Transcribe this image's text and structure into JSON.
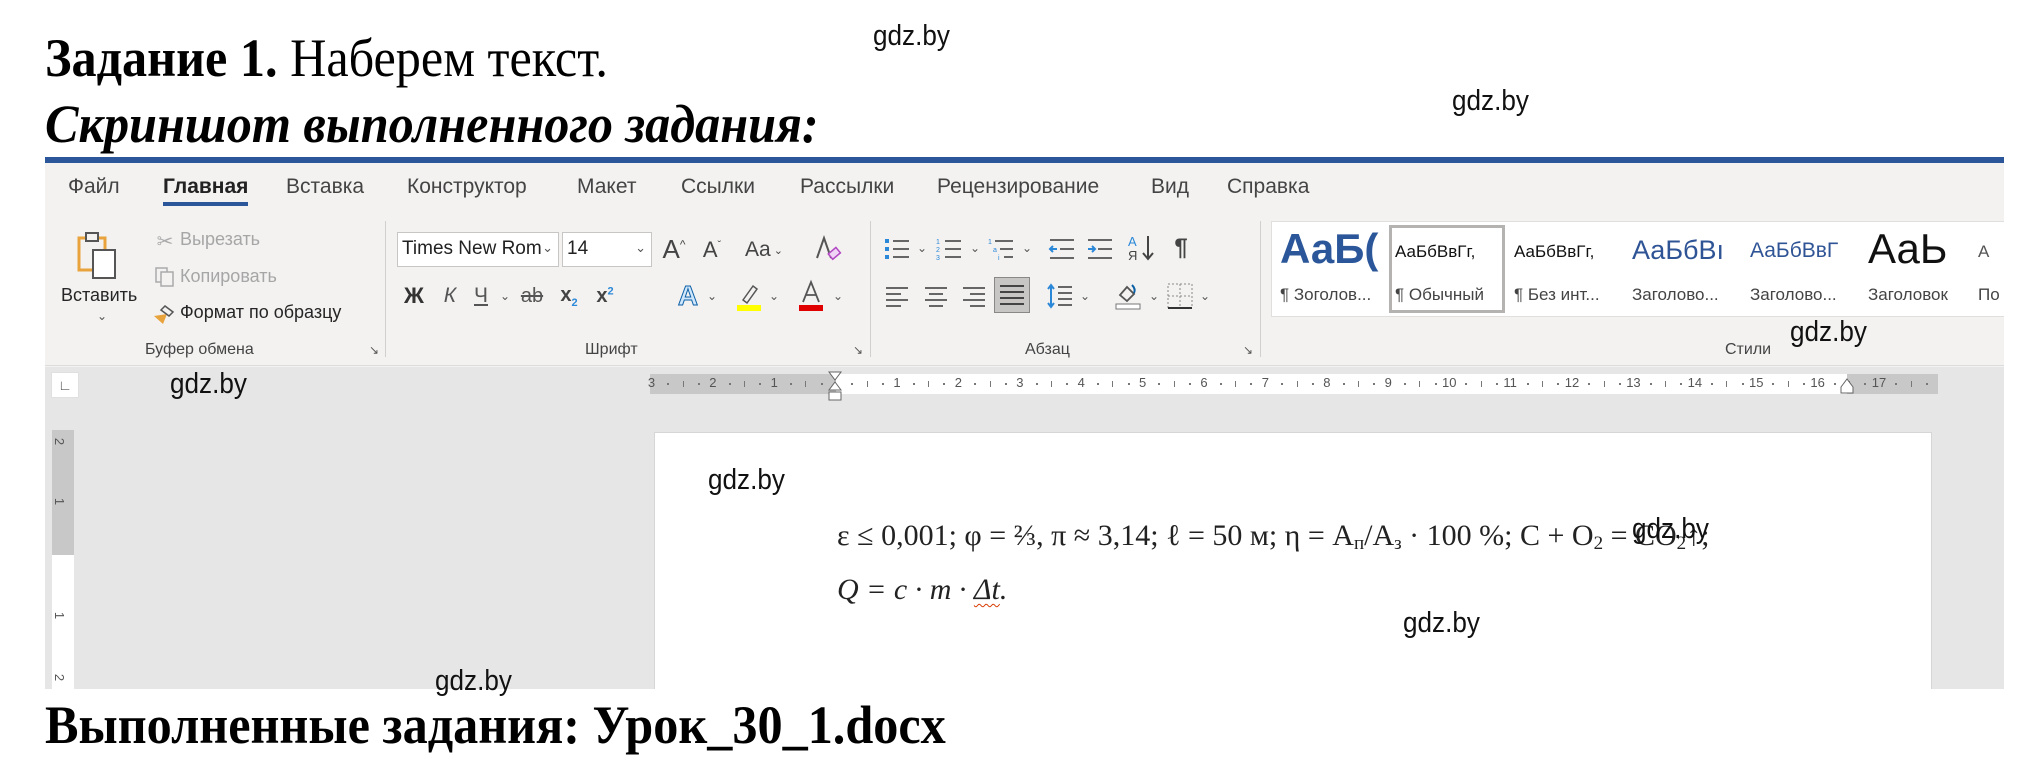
{
  "headings": {
    "task_bold": "Задание 1.",
    "task_rest": " Наберем текст.",
    "screenshot_caption": "Скриншот выполненного задания:",
    "done_caption": "Выполненные задания: Урок_30_1.docx"
  },
  "watermark": "gdz.by",
  "word": {
    "tabs": [
      {
        "label": "Файл",
        "active": false
      },
      {
        "label": "Главная",
        "active": true
      },
      {
        "label": "Вставка",
        "active": false
      },
      {
        "label": "Конструктор",
        "active": false
      },
      {
        "label": "Макет",
        "active": false
      },
      {
        "label": "Ссылки",
        "active": false
      },
      {
        "label": "Рассылки",
        "active": false
      },
      {
        "label": "Рецензирование",
        "active": false
      },
      {
        "label": "Вид",
        "active": false
      },
      {
        "label": "Справка",
        "active": false
      }
    ],
    "clipboard": {
      "paste_label": "Вставить",
      "cut_label": "Вырезать",
      "copy_label": "Копировать",
      "format_painter_label": "Формат по образцу",
      "group_label": "Буфер обмена"
    },
    "font": {
      "font_name": "Times New Rom",
      "font_size": "14",
      "group_label": "Шрифт",
      "grow_icon": "A^",
      "shrink_icon": "Aˇ",
      "case_label": "Aa",
      "bold_label": "Ж",
      "italic_label": "К",
      "underline_label": "Ч",
      "strike_label": "ab",
      "subscript_label": "x₂",
      "superscript_label": "x²",
      "highlight_color": "#ffff00",
      "font_color": "#e00000"
    },
    "paragraph": {
      "group_label": "Абзац",
      "show_marks_label": "¶",
      "sort_label": "А↓"
    },
    "styles": {
      "group_label": "Стили",
      "items": [
        {
          "preview": "АаБ(",
          "name": "¶ Зоголов...",
          "selected": false
        },
        {
          "preview": "АаБбВвГг,",
          "name": "¶ Обычный",
          "selected": true
        },
        {
          "preview": "АаБбВвГг,",
          "name": "¶ Без инт...",
          "selected": false
        },
        {
          "preview": "АаБбВı",
          "name": "Заголово...",
          "selected": false
        },
        {
          "preview": "АаБбВвГ",
          "name": "Заголово...",
          "selected": false
        },
        {
          "preview": "АаЬ",
          "name": "Заголовок",
          "selected": false
        },
        {
          "preview": "А",
          "name": "По",
          "selected": false
        }
      ]
    },
    "ruler": {
      "left_numbers": [
        "3",
        "2",
        "1"
      ],
      "right_numbers": [
        "1",
        "2",
        "3",
        "4",
        "5",
        "6",
        "7",
        "8",
        "9",
        "10",
        "11",
        "12",
        "13",
        "14",
        "15",
        "16",
        "17"
      ],
      "vertical_numbers": [
        "2",
        "1",
        "1",
        "2"
      ]
    },
    "document": {
      "line1": {
        "part1": "ε ≤ 0,001; φ = ⅔, π ≈ 3,14; ℓ = 50 м; η = A",
        "sub_p": "п",
        "part2": "/A",
        "sub_z": "з",
        "part3": " · 100 %; C + O",
        "sub_2a": "2",
        "part4": " = CO",
        "sub_2b": "2",
        "part5": "↑;"
      },
      "line2": {
        "part1": "Q = c · m · ",
        "squiggle": "Δt",
        "part2": "."
      }
    }
  },
  "colors": {
    "accent": "#2b579a",
    "ribbon_bg": "#f3f2f1",
    "doc_bg": "#e6e6e6"
  }
}
